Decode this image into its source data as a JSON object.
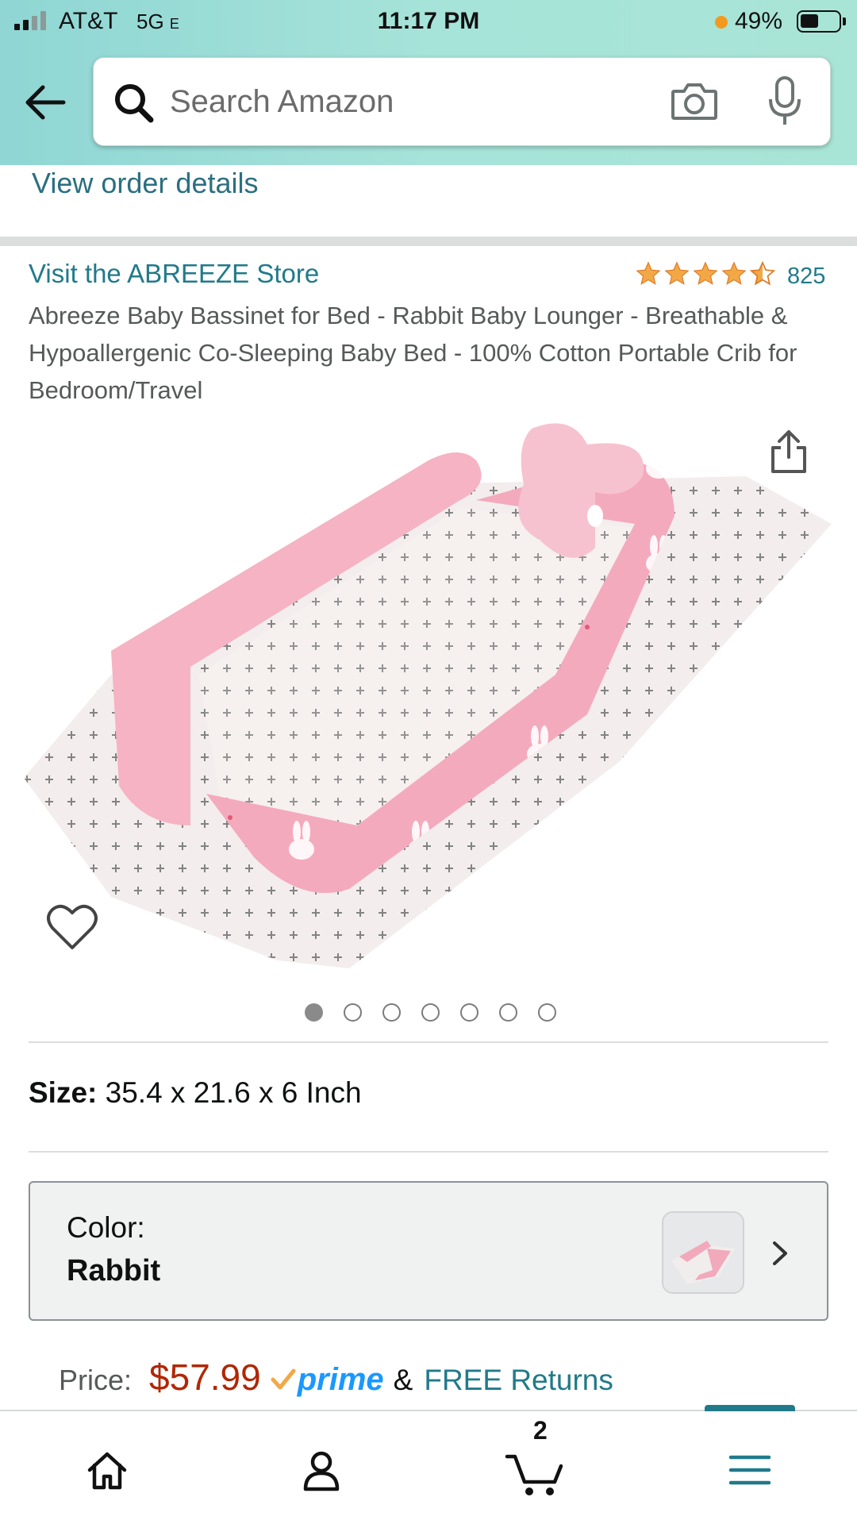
{
  "status_bar": {
    "carrier": "AT&T",
    "network": "5G",
    "network_suffix": "E",
    "time": "11:17 PM",
    "battery": "49%"
  },
  "search": {
    "placeholder": "Search Amazon"
  },
  "order": {
    "link_text": "View order details"
  },
  "product": {
    "store_link": "Visit the ABREEZE Store",
    "rating_stars": 4.5,
    "rating_count": "825",
    "title": "Abreeze Baby Bassinet for Bed - Rabbit Baby Lounger - Breathable & Hypoallergenic Co-Sleeping Baby Bed - 100% Cotton Portable Crib for Bedroom/Travel",
    "image_count": 7,
    "active_image": 1
  },
  "size": {
    "label": "Size:",
    "value": "35.4 x 21.6 x 6 Inch"
  },
  "color": {
    "label": "Color:",
    "value": "Rabbit"
  },
  "price": {
    "label": "Price:",
    "value": "$57.99",
    "prime": "prime",
    "amp": "&",
    "returns": "FREE Returns"
  },
  "bottom_nav": {
    "cart_count": "2",
    "items": [
      "home-icon",
      "account-icon",
      "cart-icon",
      "menu-icon"
    ],
    "active": "menu"
  },
  "colors": {
    "header_gradient_start": "#8fd6d4",
    "link": "#217a8a",
    "price": "#b12704",
    "star": "#f3a847",
    "prime": "#1a98ff"
  }
}
